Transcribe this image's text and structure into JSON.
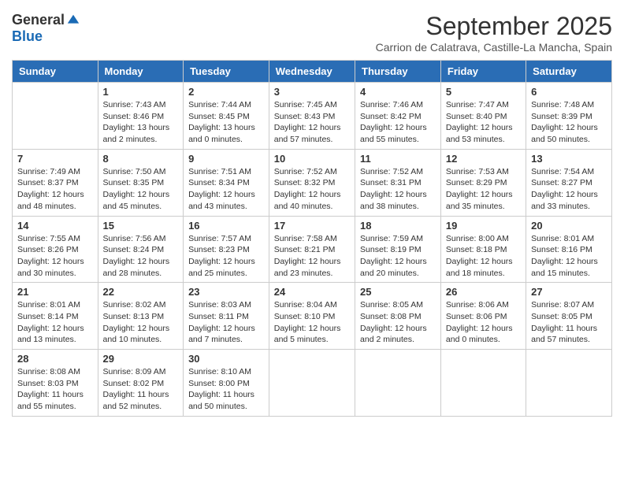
{
  "logo": {
    "general": "General",
    "blue": "Blue"
  },
  "title": "September 2025",
  "subtitle": "Carrion de Calatrava, Castille-La Mancha, Spain",
  "weekdays": [
    "Sunday",
    "Monday",
    "Tuesday",
    "Wednesday",
    "Thursday",
    "Friday",
    "Saturday"
  ],
  "weeks": [
    [
      {
        "day": "",
        "sunrise": "",
        "sunset": "",
        "daylight": ""
      },
      {
        "day": "1",
        "sunrise": "Sunrise: 7:43 AM",
        "sunset": "Sunset: 8:46 PM",
        "daylight": "Daylight: 13 hours and 2 minutes."
      },
      {
        "day": "2",
        "sunrise": "Sunrise: 7:44 AM",
        "sunset": "Sunset: 8:45 PM",
        "daylight": "Daylight: 13 hours and 0 minutes."
      },
      {
        "day": "3",
        "sunrise": "Sunrise: 7:45 AM",
        "sunset": "Sunset: 8:43 PM",
        "daylight": "Daylight: 12 hours and 57 minutes."
      },
      {
        "day": "4",
        "sunrise": "Sunrise: 7:46 AM",
        "sunset": "Sunset: 8:42 PM",
        "daylight": "Daylight: 12 hours and 55 minutes."
      },
      {
        "day": "5",
        "sunrise": "Sunrise: 7:47 AM",
        "sunset": "Sunset: 8:40 PM",
        "daylight": "Daylight: 12 hours and 53 minutes."
      },
      {
        "day": "6",
        "sunrise": "Sunrise: 7:48 AM",
        "sunset": "Sunset: 8:39 PM",
        "daylight": "Daylight: 12 hours and 50 minutes."
      }
    ],
    [
      {
        "day": "7",
        "sunrise": "Sunrise: 7:49 AM",
        "sunset": "Sunset: 8:37 PM",
        "daylight": "Daylight: 12 hours and 48 minutes."
      },
      {
        "day": "8",
        "sunrise": "Sunrise: 7:50 AM",
        "sunset": "Sunset: 8:35 PM",
        "daylight": "Daylight: 12 hours and 45 minutes."
      },
      {
        "day": "9",
        "sunrise": "Sunrise: 7:51 AM",
        "sunset": "Sunset: 8:34 PM",
        "daylight": "Daylight: 12 hours and 43 minutes."
      },
      {
        "day": "10",
        "sunrise": "Sunrise: 7:52 AM",
        "sunset": "Sunset: 8:32 PM",
        "daylight": "Daylight: 12 hours and 40 minutes."
      },
      {
        "day": "11",
        "sunrise": "Sunrise: 7:52 AM",
        "sunset": "Sunset: 8:31 PM",
        "daylight": "Daylight: 12 hours and 38 minutes."
      },
      {
        "day": "12",
        "sunrise": "Sunrise: 7:53 AM",
        "sunset": "Sunset: 8:29 PM",
        "daylight": "Daylight: 12 hours and 35 minutes."
      },
      {
        "day": "13",
        "sunrise": "Sunrise: 7:54 AM",
        "sunset": "Sunset: 8:27 PM",
        "daylight": "Daylight: 12 hours and 33 minutes."
      }
    ],
    [
      {
        "day": "14",
        "sunrise": "Sunrise: 7:55 AM",
        "sunset": "Sunset: 8:26 PM",
        "daylight": "Daylight: 12 hours and 30 minutes."
      },
      {
        "day": "15",
        "sunrise": "Sunrise: 7:56 AM",
        "sunset": "Sunset: 8:24 PM",
        "daylight": "Daylight: 12 hours and 28 minutes."
      },
      {
        "day": "16",
        "sunrise": "Sunrise: 7:57 AM",
        "sunset": "Sunset: 8:23 PM",
        "daylight": "Daylight: 12 hours and 25 minutes."
      },
      {
        "day": "17",
        "sunrise": "Sunrise: 7:58 AM",
        "sunset": "Sunset: 8:21 PM",
        "daylight": "Daylight: 12 hours and 23 minutes."
      },
      {
        "day": "18",
        "sunrise": "Sunrise: 7:59 AM",
        "sunset": "Sunset: 8:19 PM",
        "daylight": "Daylight: 12 hours and 20 minutes."
      },
      {
        "day": "19",
        "sunrise": "Sunrise: 8:00 AM",
        "sunset": "Sunset: 8:18 PM",
        "daylight": "Daylight: 12 hours and 18 minutes."
      },
      {
        "day": "20",
        "sunrise": "Sunrise: 8:01 AM",
        "sunset": "Sunset: 8:16 PM",
        "daylight": "Daylight: 12 hours and 15 minutes."
      }
    ],
    [
      {
        "day": "21",
        "sunrise": "Sunrise: 8:01 AM",
        "sunset": "Sunset: 8:14 PM",
        "daylight": "Daylight: 12 hours and 13 minutes."
      },
      {
        "day": "22",
        "sunrise": "Sunrise: 8:02 AM",
        "sunset": "Sunset: 8:13 PM",
        "daylight": "Daylight: 12 hours and 10 minutes."
      },
      {
        "day": "23",
        "sunrise": "Sunrise: 8:03 AM",
        "sunset": "Sunset: 8:11 PM",
        "daylight": "Daylight: 12 hours and 7 minutes."
      },
      {
        "day": "24",
        "sunrise": "Sunrise: 8:04 AM",
        "sunset": "Sunset: 8:10 PM",
        "daylight": "Daylight: 12 hours and 5 minutes."
      },
      {
        "day": "25",
        "sunrise": "Sunrise: 8:05 AM",
        "sunset": "Sunset: 8:08 PM",
        "daylight": "Daylight: 12 hours and 2 minutes."
      },
      {
        "day": "26",
        "sunrise": "Sunrise: 8:06 AM",
        "sunset": "Sunset: 8:06 PM",
        "daylight": "Daylight: 12 hours and 0 minutes."
      },
      {
        "day": "27",
        "sunrise": "Sunrise: 8:07 AM",
        "sunset": "Sunset: 8:05 PM",
        "daylight": "Daylight: 11 hours and 57 minutes."
      }
    ],
    [
      {
        "day": "28",
        "sunrise": "Sunrise: 8:08 AM",
        "sunset": "Sunset: 8:03 PM",
        "daylight": "Daylight: 11 hours and 55 minutes."
      },
      {
        "day": "29",
        "sunrise": "Sunrise: 8:09 AM",
        "sunset": "Sunset: 8:02 PM",
        "daylight": "Daylight: 11 hours and 52 minutes."
      },
      {
        "day": "30",
        "sunrise": "Sunrise: 8:10 AM",
        "sunset": "Sunset: 8:00 PM",
        "daylight": "Daylight: 11 hours and 50 minutes."
      },
      {
        "day": "",
        "sunrise": "",
        "sunset": "",
        "daylight": ""
      },
      {
        "day": "",
        "sunrise": "",
        "sunset": "",
        "daylight": ""
      },
      {
        "day": "",
        "sunrise": "",
        "sunset": "",
        "daylight": ""
      },
      {
        "day": "",
        "sunrise": "",
        "sunset": "",
        "daylight": ""
      }
    ]
  ]
}
